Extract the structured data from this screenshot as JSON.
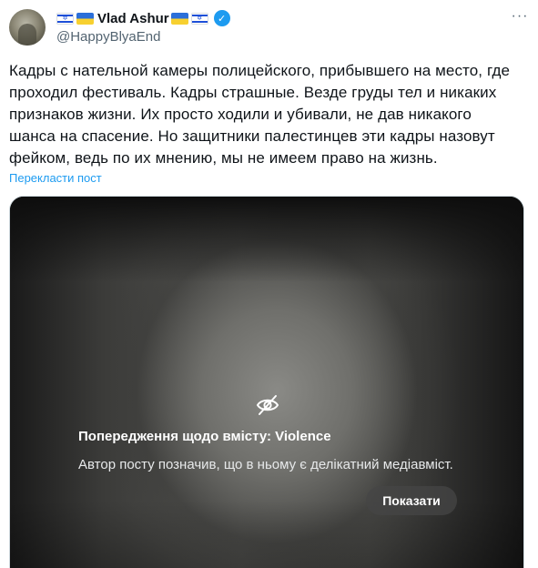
{
  "author": {
    "display_name": "Vlad Ashur",
    "handle": "@HappyBlyaEnd",
    "flags_before": [
      "israel-flag-icon",
      "ukraine-flag-icon"
    ],
    "flags_after": [
      "ukraine-flag-icon",
      "israel-flag-icon"
    ],
    "verified": true
  },
  "tweet": {
    "lines": [
      "Кадры с нательной камеры полицейского, прибывшего на место, где",
      "проходил фестиваль. Кадры страшные. Везде груды тел и никаких",
      "признаков жизни. Их просто ходили и убивали, не дав никакого",
      "шанса на спасение. Но защитники палестинцев эти кадры назовут",
      "фейком, ведь по их мнению, мы не имеем право на жизнь."
    ],
    "translate_link": "Перекласти пост"
  },
  "media_warning": {
    "icon": "eye-slash-icon",
    "title": "Попередження щодо вмісту: Violence",
    "description": "Автор посту позначив, що в ньому є делікатний медіавміст.",
    "show_button": "Показати"
  },
  "colors": {
    "accent": "#1d9bf0",
    "text": "#0f1419",
    "secondary": "#536471"
  }
}
